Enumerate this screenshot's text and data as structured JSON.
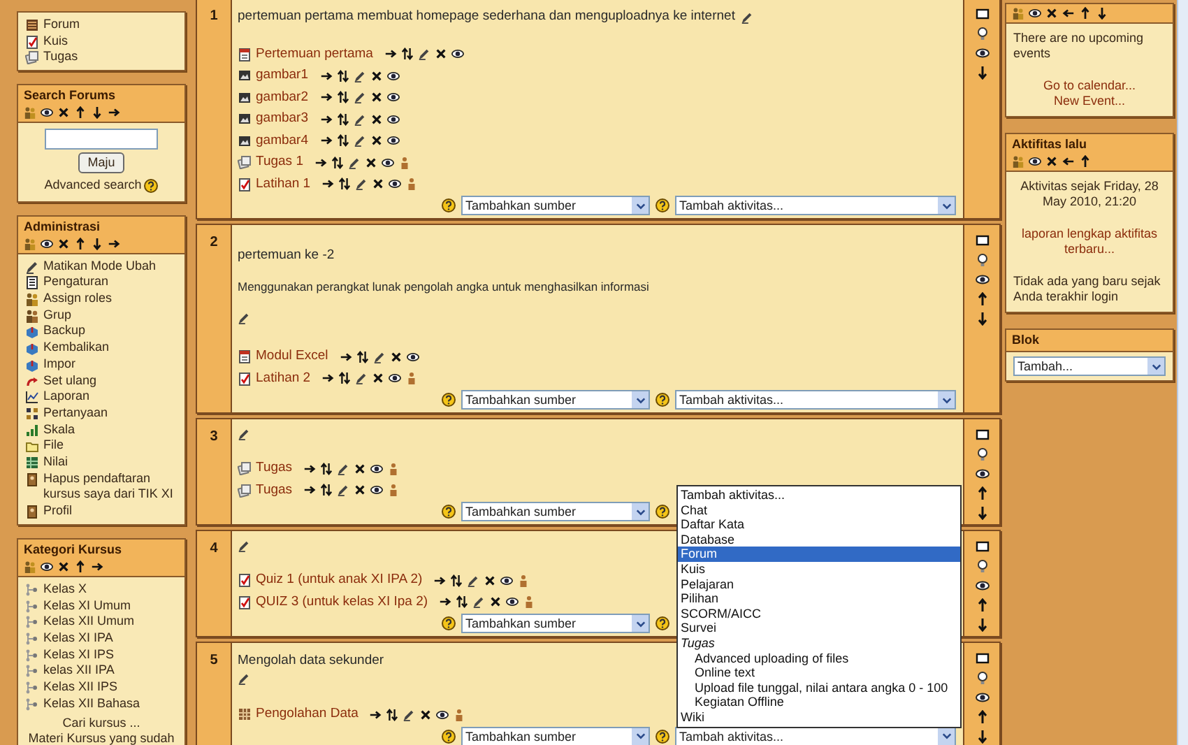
{
  "left_blocks": [
    {
      "kind": "menu",
      "items": [
        {
          "label": "Forum",
          "kind": "forum"
        },
        {
          "label": "Kuis",
          "kind": "quiz"
        },
        {
          "label": "Tugas",
          "kind": "assignment"
        }
      ]
    },
    {
      "kind": "search",
      "title": "Search Forums",
      "button": "Maju",
      "link": "Advanced search"
    },
    {
      "kind": "menu",
      "title": "Administrasi",
      "items": [
        {
          "label": "Matikan Mode Ubah",
          "kind": "edit"
        },
        {
          "label": "Pengaturan",
          "kind": "settings"
        },
        {
          "label": "Assign roles",
          "kind": "roles"
        },
        {
          "label": "Grup",
          "kind": "group"
        },
        {
          "label": "Backup",
          "kind": "backup"
        },
        {
          "label": "Kembalikan",
          "kind": "backup"
        },
        {
          "label": "Impor",
          "kind": "backup"
        },
        {
          "label": "Set ulang",
          "kind": "reset"
        },
        {
          "label": "Laporan",
          "kind": "report"
        },
        {
          "label": "Pertanyaan",
          "kind": "questions"
        },
        {
          "label": "Skala",
          "kind": "scale"
        },
        {
          "label": "File",
          "kind": "folder"
        },
        {
          "label": "Nilai",
          "kind": "grades"
        },
        {
          "label": "Hapus pendaftaran kursus saya dari TIK XI",
          "kind": "profile"
        },
        {
          "label": "Profil",
          "kind": "profile"
        }
      ]
    },
    {
      "kind": "menu",
      "title": "Kategori Kursus",
      "items": [
        {
          "label": "Kelas X",
          "kind": "category"
        },
        {
          "label": "Kelas XI Umum",
          "kind": "category"
        },
        {
          "label": "Kelas XII Umum",
          "kind": "category"
        },
        {
          "label": "Kelas XI IPA",
          "kind": "category"
        },
        {
          "label": "Kelas XI IPS",
          "kind": "category"
        },
        {
          "label": "kelas XII IPA",
          "kind": "category"
        },
        {
          "label": "Kelas XII IPS",
          "kind": "category"
        },
        {
          "label": "Kelas XII Bahasa",
          "kind": "category"
        }
      ],
      "links": [
        "Cari kursus ...",
        "Materi Kursus yang sudah"
      ]
    }
  ],
  "sections": [
    {
      "number": "1",
      "summary": [
        "pertemuan pertama membuat homepage sederhana dan menguploadnya ke internet"
      ],
      "activities": [
        {
          "name": "Pertemuan pertama",
          "kind": "resource"
        },
        {
          "name": "gambar1",
          "kind": "image"
        },
        {
          "name": "gambar2",
          "kind": "image"
        },
        {
          "name": "gambar3",
          "kind": "image"
        },
        {
          "name": "gambar4",
          "kind": "image"
        },
        {
          "name": "Tugas 1",
          "kind": "assignment"
        },
        {
          "name": "Latihan 1",
          "kind": "quiz"
        }
      ],
      "add_controls": [
        {
          "kind": "resource_select",
          "value": "Tambahkan sumber"
        },
        {
          "kind": "activity_select",
          "value": "Tambah aktivitas..."
        }
      ]
    },
    {
      "number": "2",
      "summary": [
        "pertemuan ke -2",
        "Menggunakan perangkat lunak  pengolah angka untuk menghasilkan informasi"
      ],
      "activities": [
        {
          "name": "Modul Excel",
          "kind": "resource"
        },
        {
          "name": "Latihan 2",
          "kind": "quiz"
        }
      ],
      "add_controls": [
        {
          "kind": "resource_select",
          "value": "Tambahkan sumber"
        },
        {
          "kind": "activity_select",
          "value": "Tambah aktivitas..."
        }
      ]
    },
    {
      "number": "3",
      "activities": [
        {
          "name": "Tugas",
          "kind": "assignment"
        },
        {
          "name": "Tugas",
          "kind": "assignment"
        }
      ],
      "add_controls": [
        {
          "kind": "resource_select",
          "value": "Tambahkan sumber"
        },
        {
          "kind": "help"
        }
      ]
    },
    {
      "number": "4",
      "activities": [
        {
          "name": "Quiz 1 (untuk anak XI IPA 2)",
          "kind": "quiz"
        },
        {
          "name": "QUIZ 3 (untuk kelas XI Ipa 2)",
          "kind": "quiz"
        }
      ],
      "add_controls": [
        {
          "kind": "resource_select",
          "value": "Tambahkan sumber"
        },
        {
          "kind": "help"
        }
      ]
    },
    {
      "number": "5",
      "summary": [
        "Mengolah data sekunder"
      ],
      "activities": [
        {
          "name": "Pengolahan Data",
          "kind": "data"
        }
      ],
      "add_controls": [
        {
          "kind": "resource_select",
          "value": "Tambahkan sumber"
        },
        {
          "kind": "activity_select",
          "value": "Tambah aktivitas..."
        }
      ]
    }
  ],
  "dropdown_list": {
    "items": [
      {
        "label": "Tambah aktivitas...",
        "kind": "option",
        "selected": false
      },
      {
        "label": "Chat",
        "kind": "option",
        "selected": false
      },
      {
        "label": "Daftar Kata",
        "kind": "option",
        "selected": false
      },
      {
        "label": "Database",
        "kind": "option",
        "selected": false
      },
      {
        "label": "Forum",
        "kind": "option",
        "selected": true
      },
      {
        "label": "Kuis",
        "kind": "option",
        "selected": false
      },
      {
        "label": "Pelajaran",
        "kind": "option",
        "selected": false
      },
      {
        "label": "Pilihan",
        "kind": "option",
        "selected": false
      },
      {
        "label": "SCORM/AICC",
        "kind": "option",
        "selected": false
      },
      {
        "label": "Survei",
        "kind": "option",
        "selected": false
      },
      {
        "label": "Tugas",
        "kind": "group",
        "selected": false
      },
      {
        "label": "Advanced uploading of files",
        "kind": "suboption",
        "selected": false
      },
      {
        "label": "Online text",
        "kind": "suboption",
        "selected": false
      },
      {
        "label": "Upload file tunggal, nilai antara angka 0 - 100",
        "kind": "suboption",
        "selected": false
      },
      {
        "label": "Kegiatan Offline",
        "kind": "suboption",
        "selected": false
      },
      {
        "label": "Wiki",
        "kind": "option",
        "selected": false
      }
    ]
  },
  "right_blocks": [
    {
      "kind": "text",
      "lines": [
        {
          "kind": "text",
          "text": "There are no upcoming events",
          "centered": false
        },
        {
          "kind": "link",
          "text": "Go to calendar...",
          "centered": true
        },
        {
          "kind": "link",
          "text": "New Event...",
          "centered": true
        }
      ]
    },
    {
      "kind": "text",
      "title": "Aktifitas lalu",
      "lines": [
        {
          "kind": "text",
          "text": "Aktivitas sejak Friday, 28 May 2010, 21:20",
          "centered": true
        },
        {
          "kind": "link",
          "text": "laporan lengkap aktifitas terbaru...",
          "centered": true
        },
        {
          "kind": "text",
          "text": "Tidak ada yang baru sejak Anda terakhir login",
          "centered": false
        }
      ]
    },
    {
      "kind": "select",
      "title": "Blok",
      "select": "Tambah..."
    }
  ]
}
